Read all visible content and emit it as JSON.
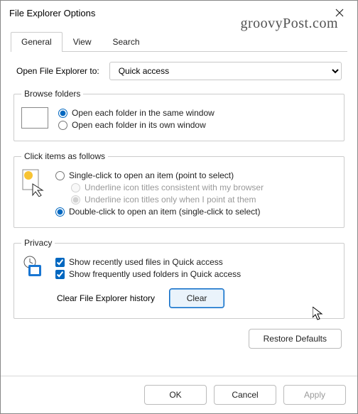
{
  "window": {
    "title": "File Explorer Options"
  },
  "watermark": "groovyPost.com",
  "tabs": {
    "general": "General",
    "view": "View",
    "search": "Search"
  },
  "open": {
    "label": "Open File Explorer to:",
    "value": "Quick access"
  },
  "browse": {
    "legend": "Browse folders",
    "same": "Open each folder in the same window",
    "own": "Open each folder in its own window"
  },
  "click": {
    "legend": "Click items as follows",
    "single": "Single-click to open an item (point to select)",
    "underline_browser": "Underline icon titles consistent with my browser",
    "underline_point": "Underline icon titles only when I point at them",
    "double": "Double-click to open an item (single-click to select)"
  },
  "privacy": {
    "legend": "Privacy",
    "recent_files": "Show recently used files in Quick access",
    "freq_folders": "Show frequently used folders in Quick access",
    "clear_label": "Clear File Explorer history",
    "clear_btn": "Clear"
  },
  "restore": "Restore Defaults",
  "footer": {
    "ok": "OK",
    "cancel": "Cancel",
    "apply": "Apply"
  }
}
